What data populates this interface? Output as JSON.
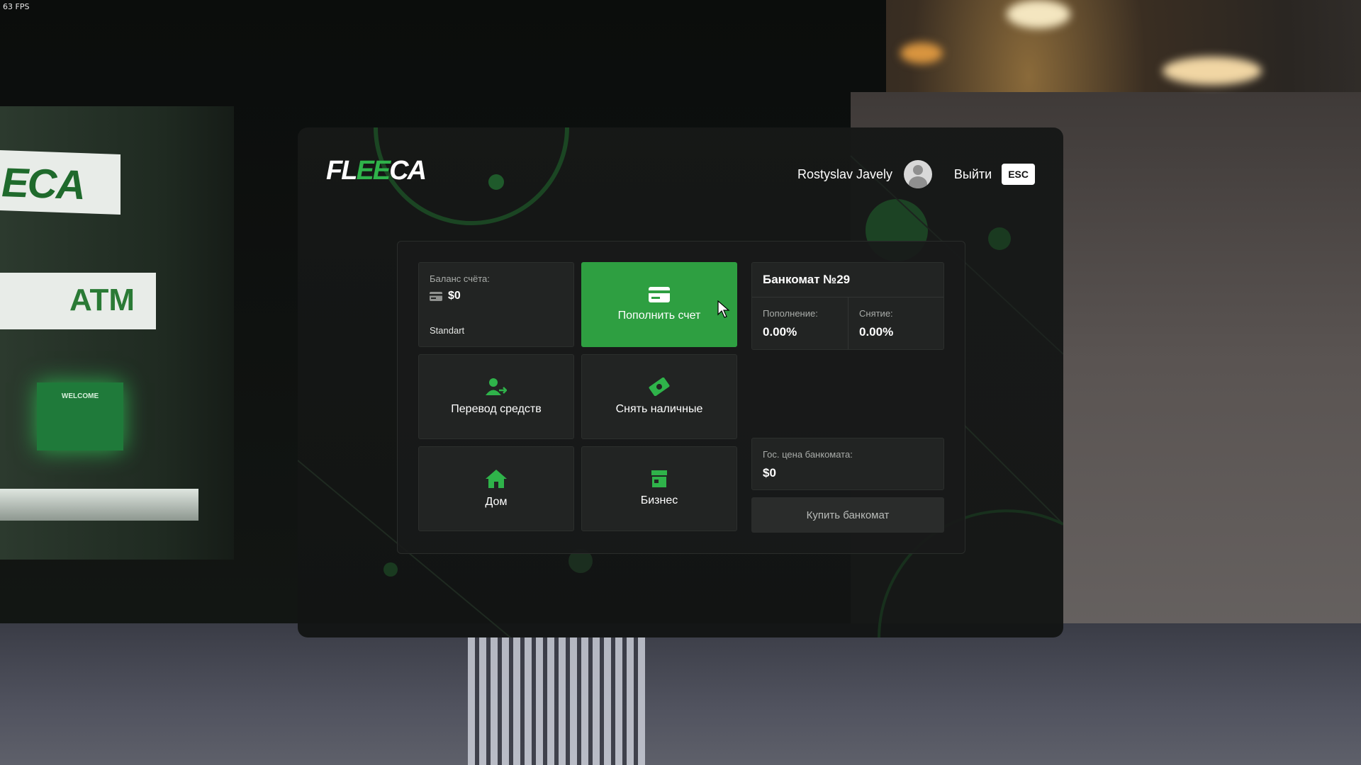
{
  "overlay": {
    "fps": "63 FPS"
  },
  "scene": {
    "atm_sign": "ECA",
    "atm_label": "ATM",
    "atm_screen_text": "WELCOME"
  },
  "header": {
    "logo": {
      "part1": "FL",
      "part2": "EE",
      "part3": "CA"
    },
    "user_name": "Rostyslav Javely",
    "exit_label": "Выйти",
    "esc_key": "ESC"
  },
  "balance": {
    "label": "Баланс счёта:",
    "amount": "$0",
    "account_type": "Standart"
  },
  "actions": {
    "deposit": "Пополнить счет",
    "transfer": "Перевод средств",
    "withdraw": "Снять наличные",
    "house": "Дом",
    "business": "Бизнес"
  },
  "atm_info": {
    "title": "Банкомат №29",
    "deposit_fee_label": "Пополнение:",
    "deposit_fee": "0.00%",
    "withdraw_fee_label": "Снятие:",
    "withdraw_fee": "0.00%"
  },
  "atm_price": {
    "label": "Гос. цена банкомата:",
    "value": "$0",
    "buy_label": "Купить банкомат"
  },
  "colors": {
    "accent": "#2e9f41",
    "panel_bg": "#161817",
    "tile_bg": "#222423"
  },
  "icons": {
    "card": "card-icon",
    "transfer": "user-transfer-icon",
    "withdraw": "cash-icon",
    "house": "house-icon",
    "business": "shop-icon"
  }
}
